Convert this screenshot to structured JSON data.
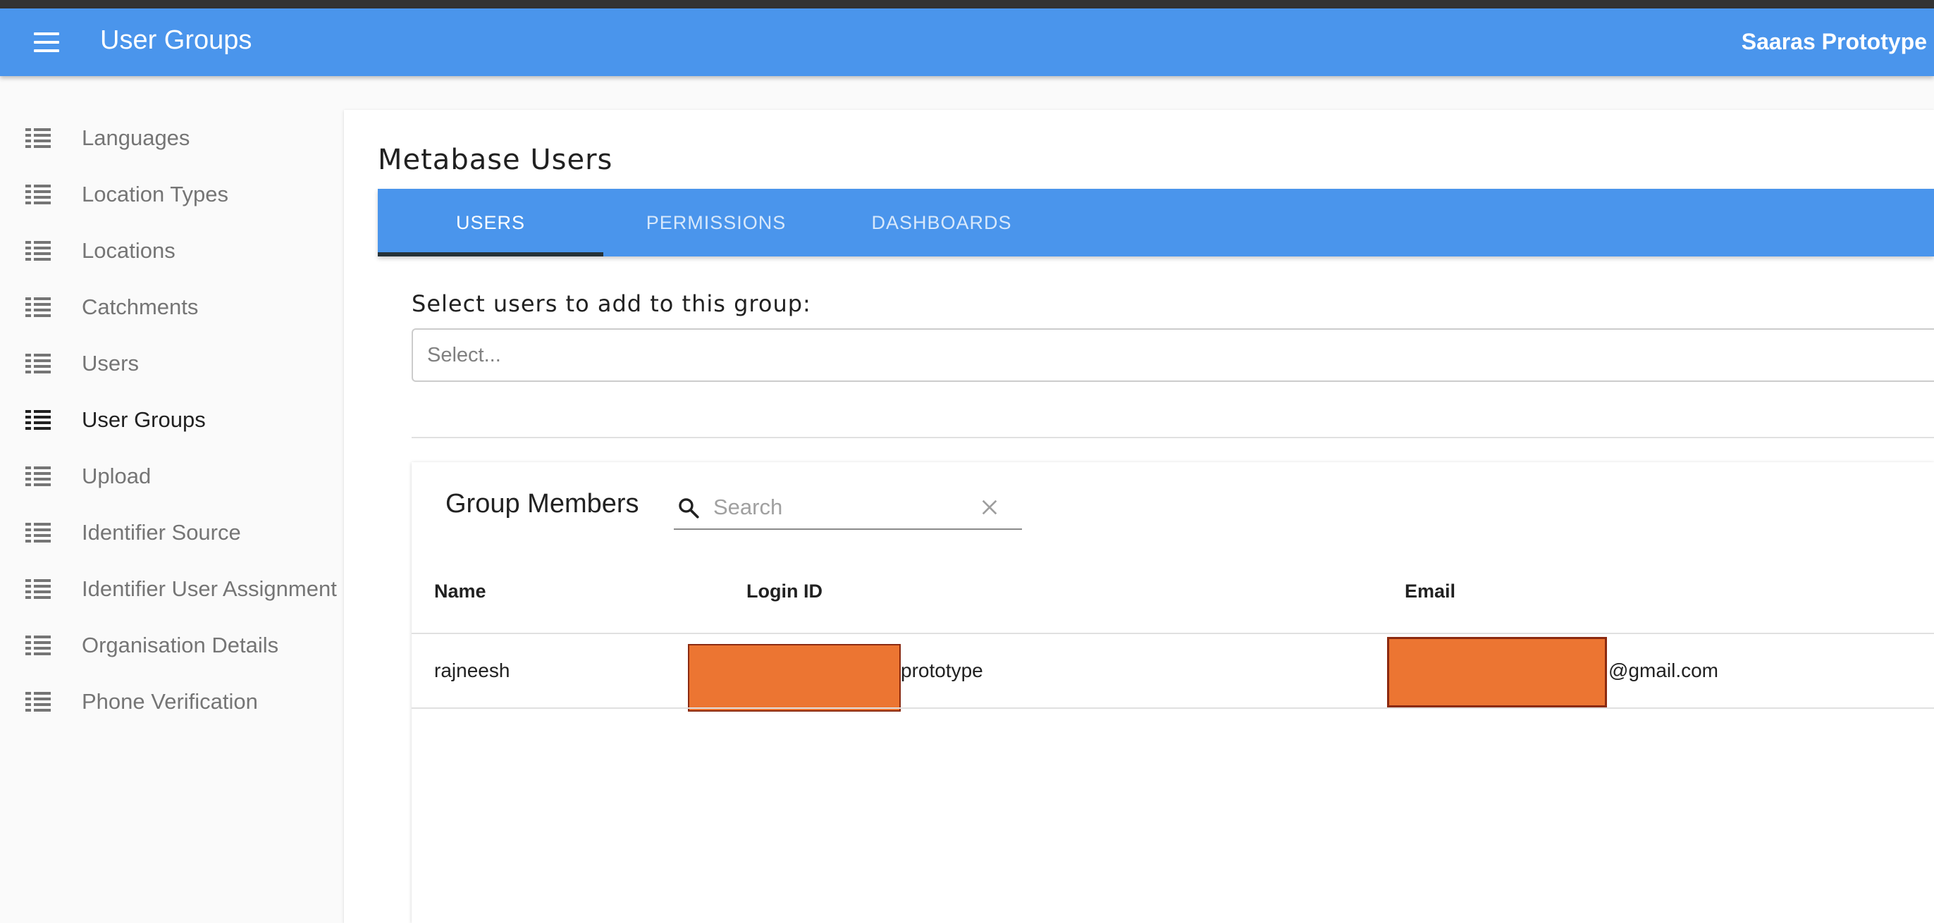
{
  "appbar": {
    "title": "User Groups",
    "org_name": "Saaras Prototype",
    "menu_icon": "hamburger-menu-icon"
  },
  "sidebar": {
    "items": [
      {
        "label": "Languages",
        "icon": "list-icon",
        "active": false
      },
      {
        "label": "Location Types",
        "icon": "list-icon",
        "active": false
      },
      {
        "label": "Locations",
        "icon": "list-icon",
        "active": false
      },
      {
        "label": "Catchments",
        "icon": "list-icon",
        "active": false
      },
      {
        "label": "Users",
        "icon": "list-icon",
        "active": false
      },
      {
        "label": "User Groups",
        "icon": "list-icon",
        "active": true
      },
      {
        "label": "Upload",
        "icon": "list-icon",
        "active": false
      },
      {
        "label": "Identifier Source",
        "icon": "list-icon",
        "active": false
      },
      {
        "label": "Identifier User Assignment",
        "icon": "list-icon",
        "active": false
      },
      {
        "label": "Organisation Details",
        "icon": "list-icon",
        "active": false
      },
      {
        "label": "Phone Verification",
        "icon": "list-icon",
        "active": false
      }
    ]
  },
  "main": {
    "section_title": "Metabase Users",
    "tabs": [
      {
        "label": "USERS",
        "active": true
      },
      {
        "label": "PERMISSIONS",
        "active": false
      },
      {
        "label": "DASHBOARDS",
        "active": false
      }
    ],
    "select_label": "Select users to add to this group:",
    "select_placeholder": "Select..."
  },
  "members": {
    "title": "Group Members",
    "search_placeholder": "Search",
    "search_icon": "search-icon",
    "clear_icon": "close-icon",
    "columns": [
      "Name",
      "Login ID",
      "Email"
    ],
    "rows": [
      {
        "name": "rajneesh",
        "login_id_suffix": "prototype",
        "email_suffix": "@gmail.com"
      }
    ]
  },
  "colors": {
    "primary": "#4a95ec",
    "redaction_fill": "#ec7532",
    "redaction_border": "#8b2a10",
    "tab_indicator": "#263238"
  }
}
